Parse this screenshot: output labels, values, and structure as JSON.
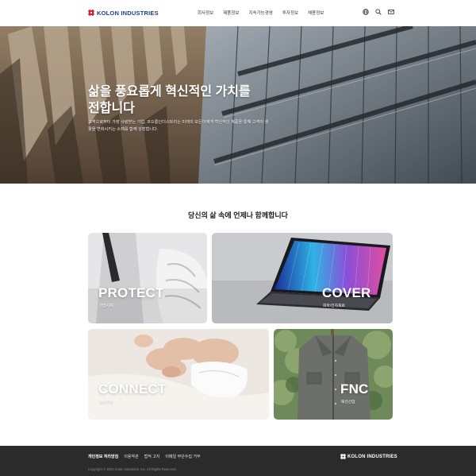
{
  "header": {
    "logo_text": "KOLON INDUSTRIES",
    "nav": [
      "회사정보",
      "제품정보",
      "지속가능경영",
      "투자정보",
      "채용정보"
    ],
    "icons": [
      "globe-icon",
      "search-icon",
      "mail-icon"
    ]
  },
  "hero": {
    "title": "삶을 풍요롭게 혁신적인 가치를 전합니다",
    "description": "고객으로부터 가장 사랑받는 기업, 코오롱인더스트리는 미래의 모든이에게 혁신적인 제품을 통해 고객의 생활을 변화시키는 소재를 함께 성장합니다."
  },
  "section": {
    "title": "당신의 삶 속에 언제나 함께합니다"
  },
  "cards": {
    "protect": {
      "title": "PROTECT",
      "sub": "산업자재"
    },
    "cover": {
      "title": "COVER",
      "sub": "화학/전자재료"
    },
    "connect": {
      "title": "CONNECT",
      "sub": "필름부문"
    },
    "fnc": {
      "title": "FNC",
      "sub": "패션산업"
    }
  },
  "footer": {
    "links": [
      "개인정보 처리방침",
      "이용약관",
      "법적 고지",
      "이메일 무단수집 거부"
    ],
    "logo_text": "KOLON INDUSTRIES",
    "copyright": "Copyright © 2022 Kolon Industries, Inc. All Rights Reserved."
  },
  "colors": {
    "brand": "#1f3d8a",
    "logo_red": "#d7192d",
    "footer_bg": "#2b2b2b"
  }
}
